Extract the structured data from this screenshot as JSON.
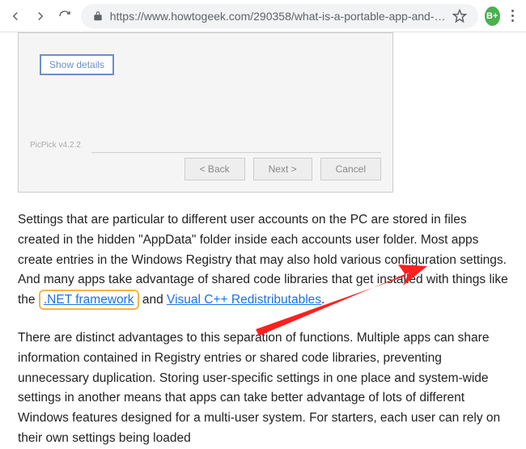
{
  "browser": {
    "url": "https://www.howtogeek.com/290358/what-is-a-portable-app-and-…",
    "ext_badge": "B+"
  },
  "installer": {
    "show_details": "Show details",
    "version": "PicPick v4.2.2",
    "back": "< Back",
    "next": "Next >",
    "cancel": "Cancel"
  },
  "article": {
    "p1_a": "Settings that are particular to different user accounts on the PC are stored in files created in the hidden \"AppData\" folder inside each accounts user folder. Most apps create entries in the Windows Registry that may also hold various configuration settings. And many apps take advantage of shared code libraries that get installed with things like the ",
    "link_net": ".NET framework",
    "p1_b": " and ",
    "link_vc": "Visual C++ Redistributables",
    "p1_c": ".",
    "p2": "There are distinct advantages to this separation of functions. Multiple apps can share information contained in Registry entries or shared code libraries, preventing unnecessary duplication. Storing user-specific settings in one place and system-wide settings in another means that apps can take better advantage of lots of different Windows features designed for a multi-user system. For starters, each user can rely on their own settings being loaded"
  }
}
